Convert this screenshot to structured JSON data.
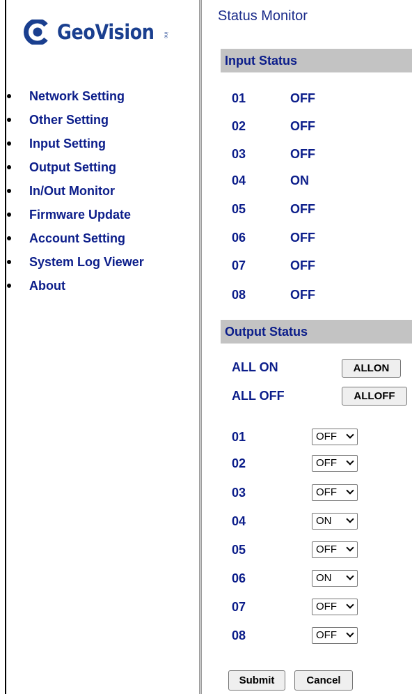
{
  "brand": {
    "name": "GeoVision",
    "inc": "inc"
  },
  "nav": [
    "Network Setting",
    "Other Setting",
    "Input Setting",
    "Output Setting",
    "In/Out Monitor",
    "Firmware Update",
    "Account Setting",
    "System Log Viewer",
    "About"
  ],
  "page_title": "Status Monitor",
  "input_status": {
    "heading": "Input Status",
    "rows": [
      {
        "id": "01",
        "state": "OFF"
      },
      {
        "id": "02",
        "state": "OFF"
      },
      {
        "id": "03",
        "state": "OFF"
      },
      {
        "id": "04",
        "state": "ON"
      },
      {
        "id": "05",
        "state": "OFF"
      },
      {
        "id": "06",
        "state": "OFF"
      },
      {
        "id": "07",
        "state": "OFF"
      },
      {
        "id": "08",
        "state": "OFF"
      }
    ]
  },
  "output_status": {
    "heading": "Output Status",
    "all_on_label": "ALL ON",
    "all_on_button": "ALLON",
    "all_off_label": "ALL OFF",
    "all_off_button": "ALLOFF",
    "rows": [
      {
        "id": "01",
        "value": "OFF"
      },
      {
        "id": "02",
        "value": "OFF"
      },
      {
        "id": "03",
        "value": "OFF"
      },
      {
        "id": "04",
        "value": "ON"
      },
      {
        "id": "05",
        "value": "OFF"
      },
      {
        "id": "06",
        "value": "ON"
      },
      {
        "id": "07",
        "value": "OFF"
      },
      {
        "id": "08",
        "value": "OFF"
      }
    ]
  },
  "buttons": {
    "submit": "Submit",
    "cancel": "Cancel"
  },
  "colors": {
    "link": "#0b1d8a",
    "section_bg": "#c3c3c3",
    "logo": "#1a3f8f"
  }
}
